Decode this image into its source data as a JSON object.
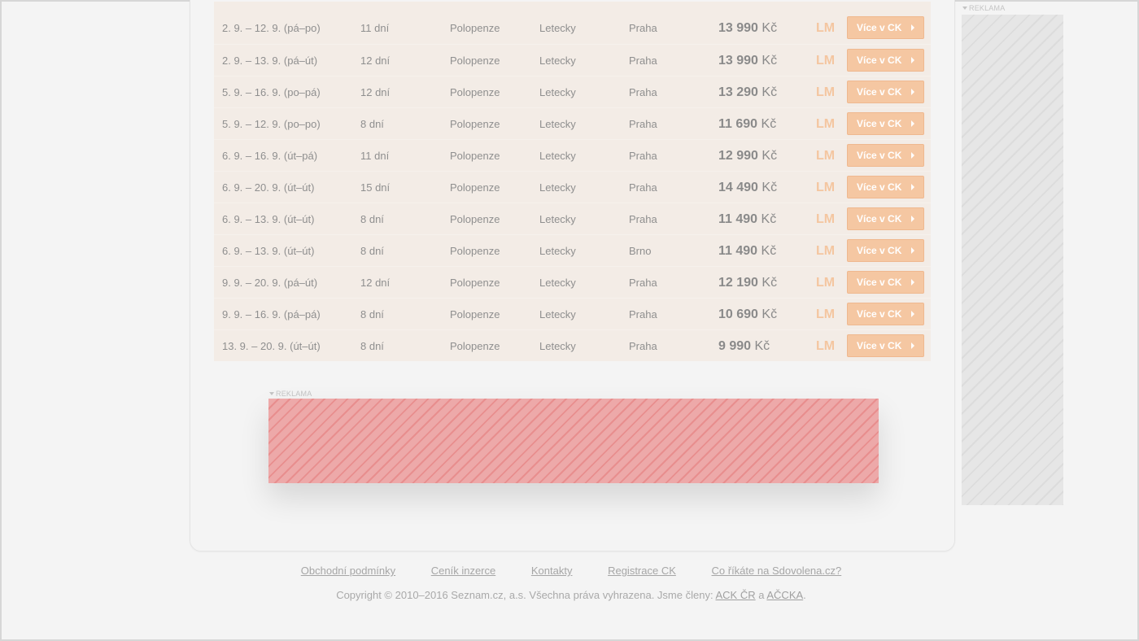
{
  "offers": [
    {
      "date": "2. 9. – 12. 9. (pá–po)",
      "length": "11 dní",
      "board": "Polopenze",
      "transport": "Letecky",
      "from": "Praha",
      "price": "13 990",
      "currency": "Kč",
      "badge": "LM",
      "button": "Více v CK"
    },
    {
      "date": "2. 9. – 13. 9. (pá–út)",
      "length": "12 dní",
      "board": "Polopenze",
      "transport": "Letecky",
      "from": "Praha",
      "price": "13 990",
      "currency": "Kč",
      "badge": "LM",
      "button": "Více v CK"
    },
    {
      "date": "5. 9. – 16. 9. (po–pá)",
      "length": "12 dní",
      "board": "Polopenze",
      "transport": "Letecky",
      "from": "Praha",
      "price": "13 290",
      "currency": "Kč",
      "badge": "LM",
      "button": "Více v CK"
    },
    {
      "date": "5. 9. – 12. 9. (po–po)",
      "length": "8 dní",
      "board": "Polopenze",
      "transport": "Letecky",
      "from": "Praha",
      "price": "11 690",
      "currency": "Kč",
      "badge": "LM",
      "button": "Více v CK"
    },
    {
      "date": "6. 9. – 16. 9. (út–pá)",
      "length": "11 dní",
      "board": "Polopenze",
      "transport": "Letecky",
      "from": "Praha",
      "price": "12 990",
      "currency": "Kč",
      "badge": "LM",
      "button": "Více v CK"
    },
    {
      "date": "6. 9. – 20. 9. (út–út)",
      "length": "15 dní",
      "board": "Polopenze",
      "transport": "Letecky",
      "from": "Praha",
      "price": "14 490",
      "currency": "Kč",
      "badge": "LM",
      "button": "Více v CK"
    },
    {
      "date": "6. 9. – 13. 9. (út–út)",
      "length": "8 dní",
      "board": "Polopenze",
      "transport": "Letecky",
      "from": "Praha",
      "price": "11 490",
      "currency": "Kč",
      "badge": "LM",
      "button": "Více v CK"
    },
    {
      "date": "6. 9. – 13. 9. (út–út)",
      "length": "8 dní",
      "board": "Polopenze",
      "transport": "Letecky",
      "from": "Brno",
      "price": "11 490",
      "currency": "Kč",
      "badge": "LM",
      "button": "Více v CK"
    },
    {
      "date": "9. 9. – 20. 9. (pá–út)",
      "length": "12 dní",
      "board": "Polopenze",
      "transport": "Letecky",
      "from": "Praha",
      "price": "12 190",
      "currency": "Kč",
      "badge": "LM",
      "button": "Více v CK"
    },
    {
      "date": "9. 9. – 16. 9. (pá–pá)",
      "length": "8 dní",
      "board": "Polopenze",
      "transport": "Letecky",
      "from": "Praha",
      "price": "10 690",
      "currency": "Kč",
      "badge": "LM",
      "button": "Více v CK"
    },
    {
      "date": "13. 9. – 20. 9. (út–út)",
      "length": "8 dní",
      "board": "Polopenze",
      "transport": "Letecky",
      "from": "Praha",
      "price": "9 990",
      "currency": "Kč",
      "badge": "LM",
      "button": "Více v CK"
    }
  ],
  "ads": {
    "side_label": "REKLAMA",
    "banner_label": "REKLAMA"
  },
  "footer": {
    "links": [
      "Obchodní podmínky",
      "Ceník inzerce",
      "Kontakty",
      "Registrace CK",
      "Co říkáte na Sdovolena.cz?"
    ],
    "copyright_prefix": "Copyright © 2010–2016 Seznam.cz, a.s. Všechna práva vyhrazena. Jsme členy:",
    "member1": "ACK ČR",
    "conj": "a",
    "member2": "AČCKA",
    "suffix": "."
  },
  "colors": {
    "button_bg": "#f5c7a2",
    "lm_badge": "#f4c6a0",
    "table_bg": "#f3ece6",
    "banner_ad": "#eda9a9"
  }
}
